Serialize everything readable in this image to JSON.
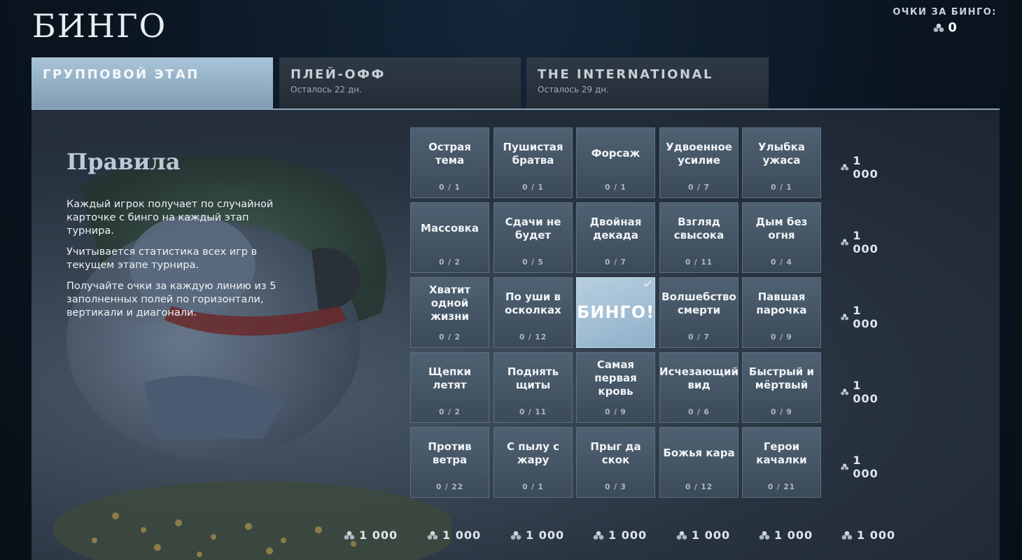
{
  "header": {
    "title": "БИНГО",
    "points_label": "ОЧКИ ЗА БИНГО:",
    "points_value": "0"
  },
  "tabs": [
    {
      "label": "ГРУППОВОЙ ЭТАП",
      "sub": "",
      "active": true
    },
    {
      "label": "ПЛЕЙ-ОФФ",
      "sub": "Осталось 22 дн.",
      "active": false
    },
    {
      "label": "THE INTERNATIONAL",
      "sub": "Осталось 29 дн.",
      "active": false
    }
  ],
  "rules": {
    "title": "Правила",
    "paragraphs": [
      "Каждый игрок получает по случайной карточке с бинго на каждый этап турнира.",
      "Учитывается статистика всех игр в текущем этапе турнира.",
      "Получайте очки за каждую линию из 5 заполненных полей по горизонтали, вертикали и диагонали."
    ]
  },
  "grid": {
    "rows": [
      [
        {
          "label": "Острая тема",
          "progress": "0 / 1"
        },
        {
          "label": "Пушистая братва",
          "progress": "0 / 1"
        },
        {
          "label": "Форсаж",
          "progress": "0 / 1"
        },
        {
          "label": "Удвоенное усилие",
          "progress": "0 / 7"
        },
        {
          "label": "Улыбка ужаса",
          "progress": "0 / 1"
        }
      ],
      [
        {
          "label": "Массовка",
          "progress": "0 / 2"
        },
        {
          "label": "Сдачи не будет",
          "progress": "0 / 5"
        },
        {
          "label": "Двойная декада",
          "progress": "0 / 7"
        },
        {
          "label": "Взгляд свысока",
          "progress": "0 / 11"
        },
        {
          "label": "Дым без огня",
          "progress": "0 / 4"
        }
      ],
      [
        {
          "label": "Хватит одной жизни",
          "progress": "0 / 2"
        },
        {
          "label": "По уши в осколках",
          "progress": "0 / 12"
        },
        {
          "label": "БИНГО!",
          "progress": "",
          "bingo": true
        },
        {
          "label": "Волшебство смерти",
          "progress": "0 / 7"
        },
        {
          "label": "Павшая парочка",
          "progress": "0 / 9"
        }
      ],
      [
        {
          "label": "Щепки летят",
          "progress": "0 / 2"
        },
        {
          "label": "Поднять щиты",
          "progress": "0 / 11"
        },
        {
          "label": "Самая первая кровь",
          "progress": "0 / 9"
        },
        {
          "label": "Исчезающий вид",
          "progress": "0 / 6"
        },
        {
          "label": "Быстрый и мёртвый",
          "progress": "0 / 9"
        }
      ],
      [
        {
          "label": "Против ветра",
          "progress": "0 / 22"
        },
        {
          "label": "С пылу с жару",
          "progress": "0 / 1"
        },
        {
          "label": "Прыг да скок",
          "progress": "0 / 3"
        },
        {
          "label": "Божья кара",
          "progress": "0 / 12"
        },
        {
          "label": "Герои качалки",
          "progress": "0 / 21"
        }
      ]
    ],
    "row_rewards": [
      "1 000",
      "1 000",
      "1 000",
      "1 000",
      "1 000"
    ],
    "column_rewards": [
      "1 000",
      "1 000",
      "1 000",
      "1 000",
      "1 000",
      "1 000",
      "1 000"
    ]
  },
  "icons": {
    "points": "coins-icon",
    "bingo_check": "check-icon"
  },
  "colors": {
    "active_tab": "#a9c4d8",
    "cell": "#4f6172",
    "bingo_cell": "#b7cfe0"
  }
}
